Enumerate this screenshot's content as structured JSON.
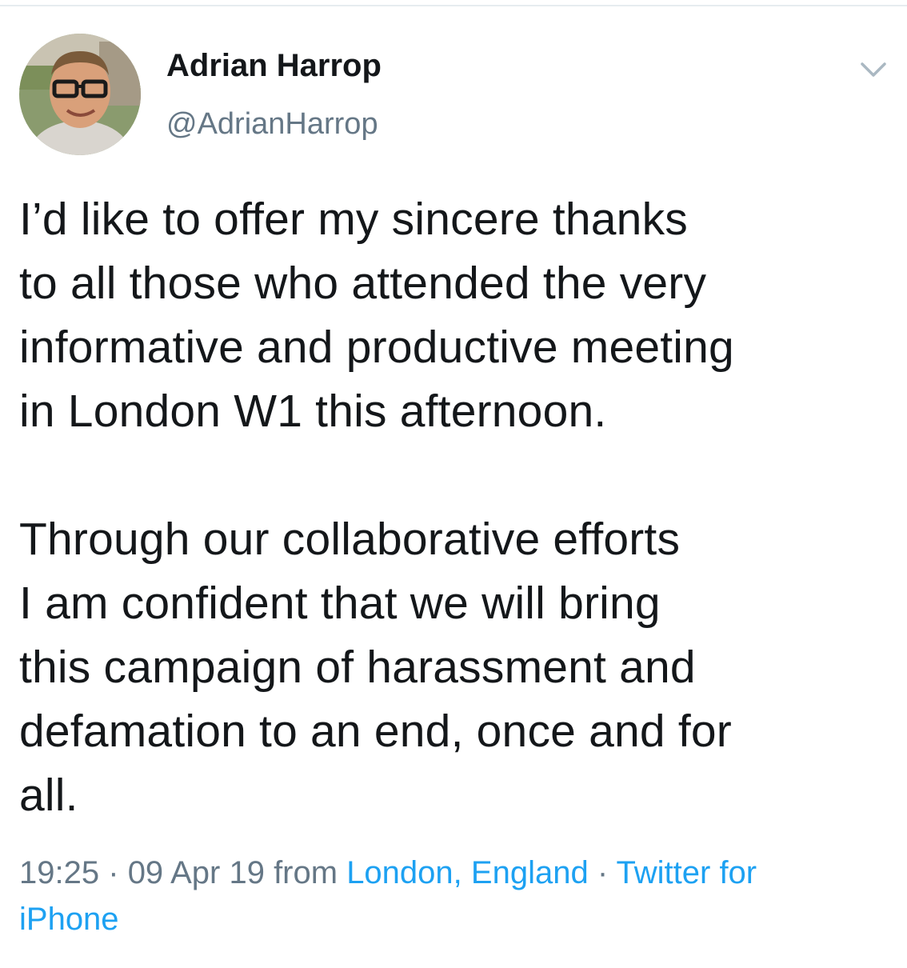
{
  "user": {
    "display_name": "Adrian Harrop",
    "handle": "@AdrianHarrop",
    "avatar_icon": "user-avatar-photo"
  },
  "menu": {
    "icon": "chevron-down-icon"
  },
  "tweet": {
    "paragraphs": [
      {
        "lines": [
          "I’d like to offer my sincere thanks",
          "to all those who attended the very",
          "informative and productive meeting",
          "in London W1 this afternoon."
        ]
      },
      {
        "lines": [
          "Through our collaborative efforts",
          "I am confident that we will bring",
          "this campaign of harassment and",
          "defamation to an end, once and for",
          "all."
        ]
      }
    ]
  },
  "meta": {
    "time": "19:25",
    "separator": "·",
    "date": "09 Apr 19",
    "from_label": "from",
    "location": "London, England",
    "source_part1": "Twitter for",
    "source_part2": "iPhone"
  },
  "colors": {
    "text": "#14171a",
    "secondary": "#657786",
    "link": "#1da1f2"
  }
}
